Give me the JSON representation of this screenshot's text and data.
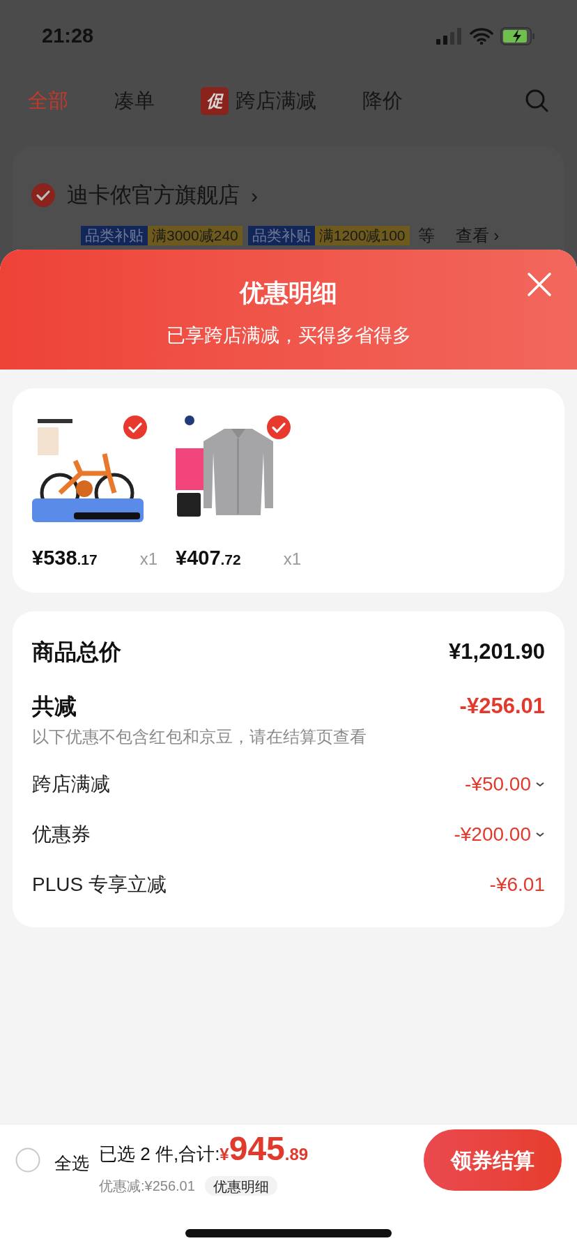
{
  "status_bar": {
    "time": "21:28"
  },
  "tabs": [
    {
      "label": "全部",
      "selected": true
    },
    {
      "label": "凑单",
      "selected": false
    },
    {
      "label": "跨店满减",
      "badge": "促",
      "selected": false
    },
    {
      "label": "降价",
      "selected": false
    }
  ],
  "store": {
    "name": "迪卡侬官方旗舰店",
    "checked": true,
    "chevron": "›",
    "tags": [
      {
        "label": "品类补贴",
        "value": "满3000减240"
      },
      {
        "label": "品类补贴",
        "value": "满1200减100"
      }
    ],
    "more": "等",
    "view": "查看",
    "view_chevron": "›"
  },
  "sheet": {
    "title": "优惠明细",
    "subtitle": "已享跨店满减，买得多省得多",
    "products": [
      {
        "kind": "bike",
        "checked": true,
        "price": "¥538",
        "cents": ".17",
        "qty": "x1"
      },
      {
        "kind": "shirt",
        "checked": true,
        "price": "¥407",
        "cents": ".72",
        "qty": "x1"
      }
    ],
    "summary": {
      "total": {
        "label": "商品总价",
        "value": "¥1,201.90"
      },
      "discount": {
        "label": "共减",
        "value": "-¥256.01",
        "note": "以下优惠不包含红包和京豆，请在结算页查看"
      },
      "items": [
        {
          "label": "跨店满减",
          "value": "-¥50.00",
          "expandable": true
        },
        {
          "label": "优惠券",
          "value": "-¥200.00",
          "expandable": true
        },
        {
          "label": "PLUS 专享立减",
          "value": "-¥6.01",
          "expandable": false
        }
      ]
    }
  },
  "bottom_bar": {
    "select_all": {
      "label": "全选",
      "checked": false
    },
    "selected_text": "已选 2 件,合计:",
    "currency": "¥",
    "total": "945",
    "cents": ".89",
    "saving": "优惠减:¥256.01",
    "detail_button": "优惠明细",
    "checkout": "领券结算"
  }
}
